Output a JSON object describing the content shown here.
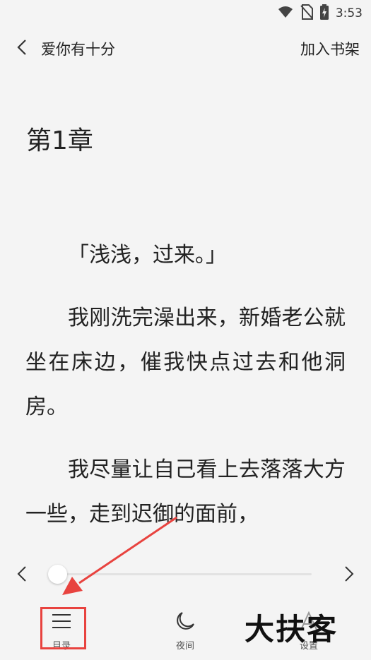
{
  "status_bar": {
    "time": "3:53",
    "icons": [
      "wifi-icon",
      "no-sim-icon",
      "battery-charging-icon"
    ]
  },
  "top_bar": {
    "book_title": "爱你有十分",
    "add_to_shelf": "加入书架"
  },
  "chapter": {
    "title": "第1章",
    "paragraphs": [
      "「浅浅，过来。」",
      "我刚洗完澡出来，新婚老公就坐在床边，催我快点过去和他洞房。",
      "我尽量让自己看上去落落大方一些，走到迟御的面前，"
    ]
  },
  "progress": {
    "value": 0
  },
  "bottom_bar": {
    "toc_label": "目录",
    "night_label": "夜间",
    "settings_label": "设置"
  },
  "watermark": "大扶客",
  "colors": {
    "background": "#f4f4f4",
    "annotation": "#e8433f",
    "text": "#222222"
  }
}
